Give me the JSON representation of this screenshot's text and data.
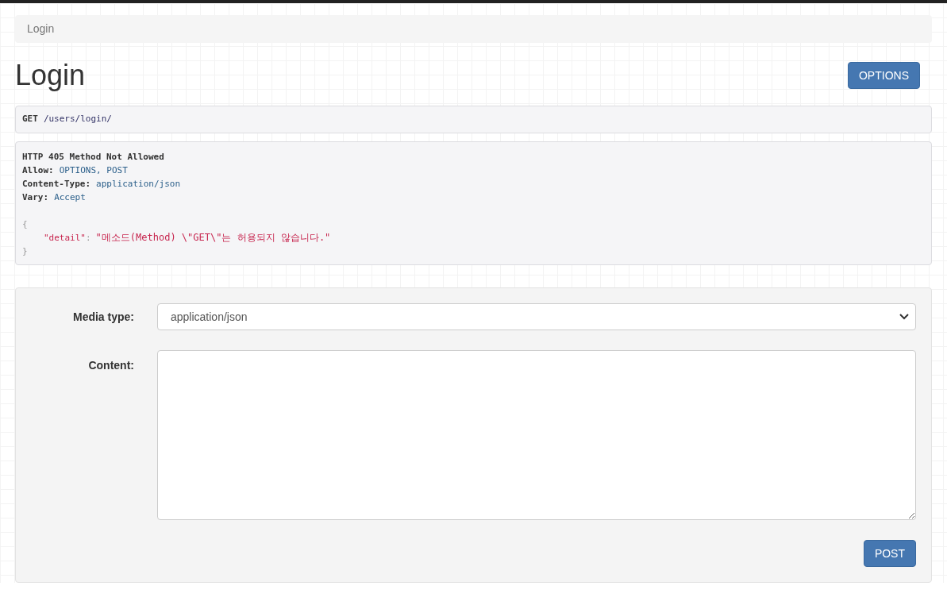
{
  "breadcrumb": [
    {
      "label": "Login",
      "selected": true
    }
  ],
  "title": "Login",
  "options_button": "OPTIONS",
  "request": {
    "method": "GET",
    "path": "/users/login/"
  },
  "response": {
    "status_line": "HTTP 405 Method Not Allowed",
    "headers": [
      {
        "name": "Allow:",
        "value": "OPTIONS, POST"
      },
      {
        "name": "Content-Type:",
        "value": "application/json"
      },
      {
        "name": "Vary:",
        "value": "Accept"
      }
    ],
    "body": {
      "open": "{",
      "key": "\"detail\"",
      "sep": ":",
      "value": "\"메소드(Method) \\\"GET\\\"는 허용되지 않습니다.\"",
      "close": "}"
    }
  },
  "form": {
    "media_type_label": "Media type:",
    "media_type_value": "application/json",
    "content_label": "Content:",
    "submit": "POST"
  }
}
